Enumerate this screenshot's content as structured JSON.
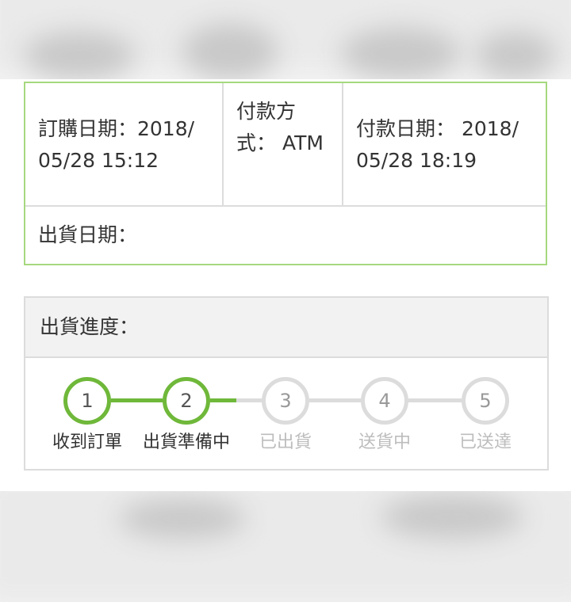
{
  "order": {
    "order_date": "訂購日期：2018/ 05/28 15:12",
    "payment_method": "付款方式： ATM",
    "payment_date": "付款日期： 2018/ 05/28 18:19",
    "ship_date": "出貨日期："
  },
  "progress": {
    "title": "出貨進度：",
    "current_step": 2,
    "steps": [
      {
        "number": "1",
        "label": "收到訂單"
      },
      {
        "number": "2",
        "label": "出貨準備中"
      },
      {
        "number": "3",
        "label": "已出貨"
      },
      {
        "number": "4",
        "label": "送貨中"
      },
      {
        "number": "5",
        "label": "已送達"
      }
    ]
  },
  "colors": {
    "accent": "#6fb83a",
    "table_border": "#a6d87e",
    "inactive": "#dcdcdc",
    "inactive_text": "#bdbdbd"
  }
}
